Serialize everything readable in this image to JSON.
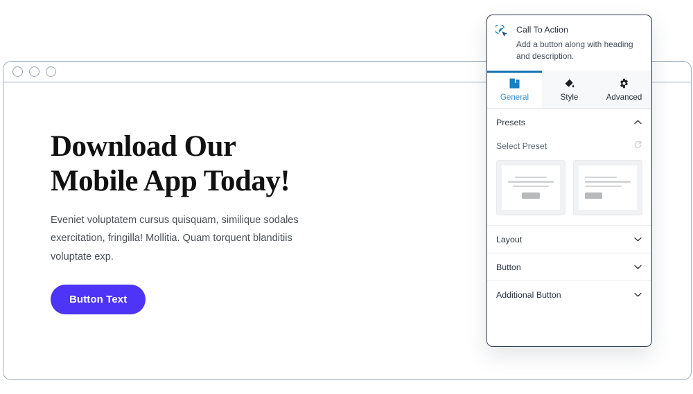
{
  "browser": {
    "window_dots": [
      "dot-1",
      "dot-2",
      "dot-3"
    ]
  },
  "page_content": {
    "heading": "Download Our\nMobile App Today!",
    "description": "Eveniet voluptatem cursus quisquam, similique sodales exercitation, fringilla! Mollitia. Quam torquent blanditiis voluptate exp.",
    "button_label": "Button Text",
    "button_color": "#4d34f7",
    "heading_color": "#111111",
    "description_color": "#4a4f57"
  },
  "panel": {
    "widget_icon": "click-target-icon",
    "title": "Call To Action",
    "subtitle": "Add a button along with heading and description.",
    "accent_color": "#1673b5",
    "tabs": [
      {
        "label": "General",
        "icon": "block-square-icon",
        "active": true
      },
      {
        "label": "Style",
        "icon": "paint-bucket-icon",
        "active": false
      },
      {
        "label": "Advanced",
        "icon": "gear-icon",
        "active": false
      }
    ],
    "sections": [
      {
        "label": "Presets",
        "expanded": true,
        "chevron": "chevron-up-icon"
      },
      {
        "label": "Layout",
        "expanded": false,
        "chevron": "chevron-down-icon"
      },
      {
        "label": "Button",
        "expanded": false,
        "chevron": "chevron-down-icon"
      },
      {
        "label": "Additional Button",
        "expanded": false,
        "chevron": "chevron-down-icon"
      }
    ],
    "presets": {
      "label": "Select Preset",
      "reset_icon": "reset-circle-icon",
      "options": [
        {
          "name": "preset-centered",
          "align": "center"
        },
        {
          "name": "preset-left",
          "align": "left"
        }
      ]
    }
  }
}
